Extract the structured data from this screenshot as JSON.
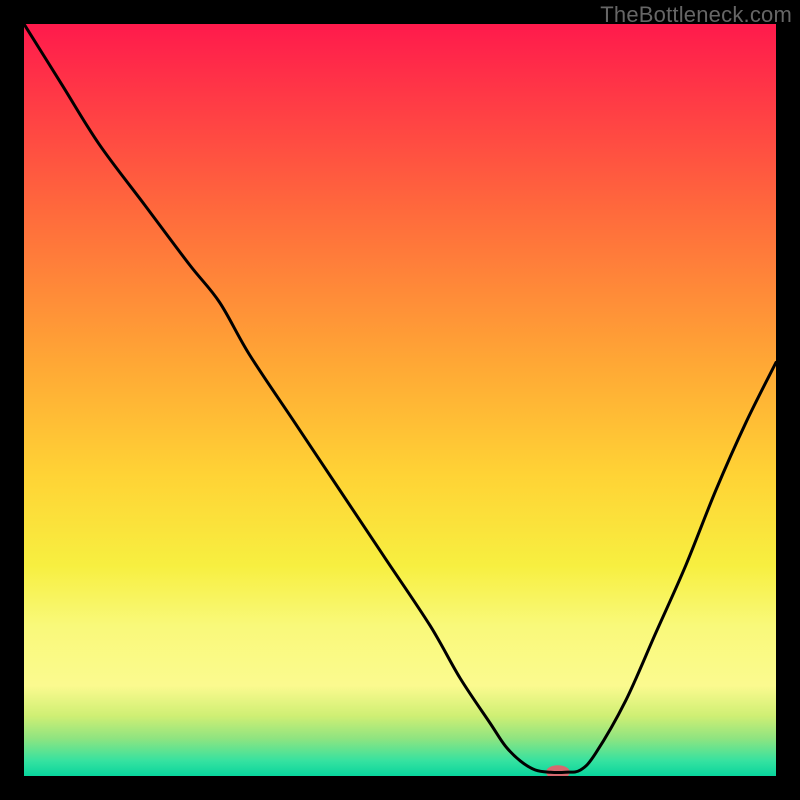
{
  "watermark": "TheBottleneck.com",
  "chart_data": {
    "type": "line",
    "title": "",
    "xlabel": "",
    "ylabel": "",
    "xlim": [
      0,
      100
    ],
    "ylim": [
      0,
      100
    ],
    "gradient_stops": [
      {
        "offset": 0,
        "color": "#ff1a4c"
      },
      {
        "offset": 25,
        "color": "#ff6a3c"
      },
      {
        "offset": 45,
        "color": "#ffa735"
      },
      {
        "offset": 60,
        "color": "#ffd335"
      },
      {
        "offset": 72,
        "color": "#f7ef40"
      },
      {
        "offset": 80,
        "color": "#f9f97a"
      },
      {
        "offset": 88,
        "color": "#fbfa8f"
      },
      {
        "offset": 92,
        "color": "#cfef74"
      },
      {
        "offset": 95,
        "color": "#8fe480"
      },
      {
        "offset": 98,
        "color": "#35e2a0"
      },
      {
        "offset": 100,
        "color": "#08d59d"
      }
    ],
    "series": [
      {
        "name": "bottleneck-curve",
        "x": [
          0,
          5,
          10,
          16,
          22,
          26,
          30,
          36,
          42,
          48,
          54,
          58,
          62,
          64,
          66,
          68,
          70,
          72,
          74,
          76,
          80,
          84,
          88,
          92,
          96,
          100
        ],
        "y": [
          100,
          92,
          84,
          76,
          68,
          63,
          56,
          47,
          38,
          29,
          20,
          13,
          7,
          4,
          2,
          0.8,
          0.5,
          0.5,
          0.8,
          3,
          10,
          19,
          28,
          38,
          47,
          55
        ]
      }
    ],
    "marker": {
      "x": 71,
      "y": 0.5,
      "color": "#d66a6f",
      "rx": 12,
      "ry": 7
    }
  }
}
